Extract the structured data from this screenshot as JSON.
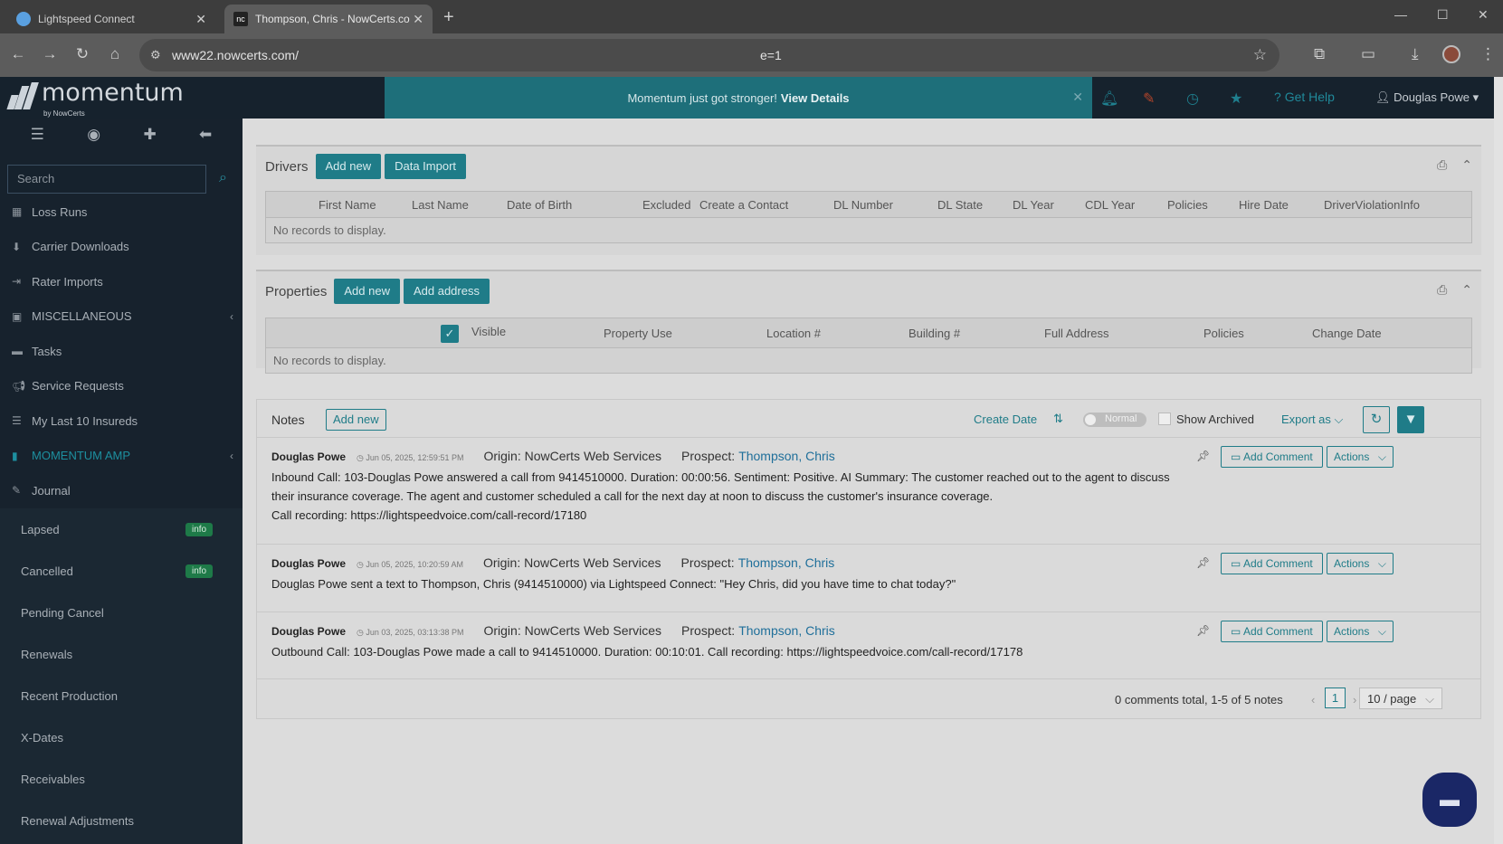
{
  "browser": {
    "tabs": [
      {
        "title": "Lightspeed Connect"
      },
      {
        "title": "Thompson, Chris - NowCerts.co"
      }
    ],
    "url": "www22.nowcerts.com/",
    "url_suffix": "e=1"
  },
  "header": {
    "brand": "momentum",
    "brand_sub": "by NowCerts",
    "banner_text": "Momentum just got stronger!",
    "banner_link": "View Details",
    "get_help": "Get Help",
    "user": "Douglas Powe"
  },
  "sidebar": {
    "search_placeholder": "Search",
    "items": [
      {
        "label": "Loss Runs",
        "icon": "table-icon"
      },
      {
        "label": "Carrier Downloads",
        "icon": "download-icon"
      },
      {
        "label": "Rater Imports",
        "icon": "import-icon"
      },
      {
        "label": "MISCELLANEOUS",
        "icon": "misc-icon"
      },
      {
        "label": "Tasks",
        "icon": "tasks-icon"
      },
      {
        "label": "Service Requests",
        "icon": "megaphone-icon"
      },
      {
        "label": "My Last 10 Insureds",
        "icon": "list-icon"
      },
      {
        "label": "MOMENTUM AMP",
        "icon": "amp-icon"
      },
      {
        "label": "Journal",
        "icon": "pencil-icon"
      }
    ],
    "subitems": [
      {
        "label": "Lapsed",
        "badge": "info"
      },
      {
        "label": "Cancelled",
        "badge": "info"
      },
      {
        "label": "Pending Cancel"
      },
      {
        "label": "Renewals"
      },
      {
        "label": "Recent Production"
      },
      {
        "label": "X-Dates"
      },
      {
        "label": "Receivables"
      },
      {
        "label": "Renewal Adjustments"
      }
    ]
  },
  "drivers": {
    "title": "Drivers",
    "add_new": "Add new",
    "data_import": "Data Import",
    "columns": [
      "First Name",
      "Last Name",
      "Date of Birth",
      "Excluded",
      "Create a Contact",
      "DL Number",
      "DL State",
      "DL Year",
      "CDL Year",
      "Policies",
      "Hire Date",
      "DriverViolationInfo"
    ],
    "empty": "No records to display."
  },
  "properties": {
    "title": "Properties",
    "add_new": "Add new",
    "add_address": "Add address",
    "columns": [
      "Visible",
      "Property Use",
      "Location #",
      "Building #",
      "Full Address",
      "Policies",
      "Change Date"
    ],
    "empty": "No records to display."
  },
  "notes": {
    "title": "Notes",
    "add_new": "Add new",
    "sort_by": "Create Date",
    "toggle_label": "Normal",
    "show_archived": "Show Archived",
    "export_as": "Export as",
    "items": [
      {
        "author": "Douglas Powe",
        "date": "Jun 05, 2025, 12:59:51 PM",
        "origin": "Origin: NowCerts Web Services",
        "prospect_label": "Prospect:",
        "prospect": "Thompson, Chris",
        "body_lines": [
          "Inbound Call: 103-Douglas Powe answered a call from 9414510000. Duration: 00:00:56. Sentiment: Positive. AI Summary: The customer reached out to the agent to discuss",
          "their insurance coverage. The agent and customer scheduled a call for the next day at noon to discuss the customer's insurance coverage.",
          "Call recording: https://lightspeedvoice.com/call-record/17180"
        ],
        "add_comment": "Add Comment",
        "actions": "Actions"
      },
      {
        "author": "Douglas Powe",
        "date": "Jun 05, 2025, 10:20:59 AM",
        "origin": "Origin: NowCerts Web Services",
        "prospect_label": "Prospect:",
        "prospect": "Thompson, Chris",
        "body_lines": [
          "Douglas Powe sent a text to Thompson, Chris (9414510000) via Lightspeed Connect: \"Hey Chris, did you have time to chat today?\""
        ],
        "add_comment": "Add Comment",
        "actions": "Actions"
      },
      {
        "author": "Douglas Powe",
        "date": "Jun 03, 2025, 03:13:38 PM",
        "origin": "Origin: NowCerts Web Services",
        "prospect_label": "Prospect:",
        "prospect": "Thompson, Chris",
        "body_lines": [
          "Outbound Call: 103-Douglas Powe made a call to 9414510000. Duration: 00:10:01. Call recording: https://lightspeedvoice.com/call-record/17178"
        ],
        "add_comment": "Add Comment",
        "actions": "Actions"
      }
    ],
    "pagination": {
      "summary": "0 comments total, 1-5 of 5 notes",
      "current_page": "1",
      "page_size": "10 / page"
    }
  },
  "colors": {
    "accent": "#1f7c88",
    "sidebar_bg": "#17222d",
    "badge": "#1e7a48",
    "chat_fab": "#1a2766"
  }
}
